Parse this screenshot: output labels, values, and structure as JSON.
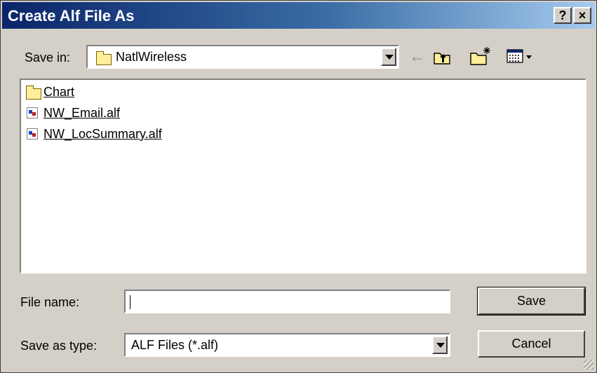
{
  "window": {
    "title": "Create Alf File As",
    "help_glyph": "?",
    "close_glyph": "×"
  },
  "save_in": {
    "label": "Save in:",
    "value": "NatlWireless",
    "folder_icon": "folder-icon"
  },
  "toolbar": {
    "back_glyph": "←",
    "up_icon": "up-one-level-icon",
    "new_folder_icon": "new-folder-icon",
    "view_menu_icon": "view-menu-icon"
  },
  "files": [
    {
      "name": "Chart",
      "icon": "folder-icon"
    },
    {
      "name": "NW_Email.alf",
      "icon": "alf-file-icon"
    },
    {
      "name": "NW_LocSummary.alf",
      "icon": "alf-file-icon"
    }
  ],
  "file_name": {
    "label": "File name:",
    "value": ""
  },
  "save_as_type": {
    "label": "Save as type:",
    "value": "ALF Files (*.alf)"
  },
  "buttons": {
    "save": "Save",
    "cancel": "Cancel"
  }
}
